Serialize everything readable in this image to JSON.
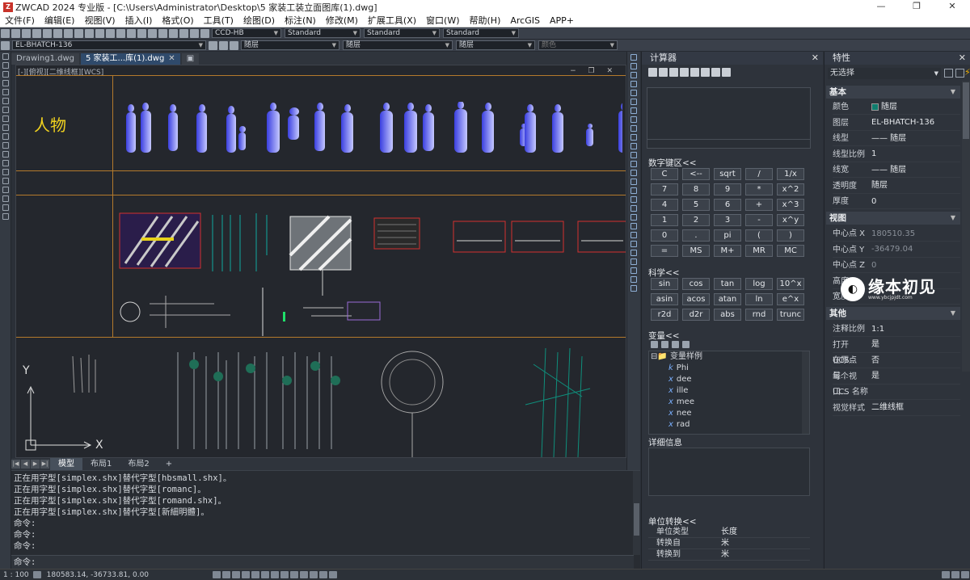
{
  "title_bar": {
    "text": "ZWCAD 2024 专业版 - [C:\\Users\\Administrator\\Desktop\\5 家装工装立面图库(1).dwg]",
    "controls": [
      "—",
      "❐",
      "✕"
    ]
  },
  "menu": [
    "文件(F)",
    "编辑(E)",
    "视图(V)",
    "插入(I)",
    "格式(O)",
    "工具(T)",
    "绘图(D)",
    "标注(N)",
    "修改(M)",
    "扩展工具(X)",
    "窗口(W)",
    "帮助(H)",
    "ArcGIS",
    "APP+"
  ],
  "toolbar": {
    "text_style": "CCD-HB",
    "dim_style": "Standard",
    "table_style": "Standard",
    "multileader_style": "Standard",
    "layer": "EL-BHATCH-136",
    "color": "随层",
    "linetype": "随层",
    "lineweight": "随层",
    "plot_style": "颜色"
  },
  "doc_tabs": [
    {
      "label": "Drawing1.dwg",
      "active": false
    },
    {
      "label": "5 家装工...库(1).dwg",
      "active": true
    }
  ],
  "viewport": {
    "label": "[-][俯视][二维线框][WCS]",
    "controls": "− ❐ ✕",
    "section_title": "人物",
    "ucs_y": "Y",
    "ucs_x": "X"
  },
  "layout_tabs": [
    "模型",
    "布局1",
    "布局2",
    "+"
  ],
  "command": {
    "lines": [
      "正在用字型[simplex.shx]替代字型[hbsmall.shx]。",
      "正在用字型[simplex.shx]替代字型[romanc]。",
      "正在用字型[simplex.shx]替代字型[romand.shx]。",
      "正在用字型[simplex.shx]替代字型[新細明體]。",
      "命令:",
      "命令:",
      "命令:"
    ],
    "prompt": "命令:"
  },
  "status": {
    "scale": "1 : 100",
    "coords": "180583.14, -36733.81, 0.00"
  },
  "calculator": {
    "title": "计算器",
    "numpad_title": "数字键区<<",
    "numpad": [
      [
        "C",
        "<--",
        "sqrt",
        "/",
        "1/x"
      ],
      [
        "7",
        "8",
        "9",
        "*",
        "x^2"
      ],
      [
        "4",
        "5",
        "6",
        "+",
        "x^3"
      ],
      [
        "1",
        "2",
        "3",
        "-",
        "x^y"
      ],
      [
        "0",
        ".",
        "pi",
        "(",
        ")"
      ],
      [
        "=",
        "MS",
        "M+",
        "MR",
        "MC"
      ]
    ],
    "sci_title": "科学<<",
    "sci": [
      [
        "sin",
        "cos",
        "tan",
        "log",
        "10^x"
      ],
      [
        "asin",
        "acos",
        "atan",
        "ln",
        "e^x"
      ],
      [
        "r2d",
        "d2r",
        "abs",
        "rnd",
        "trunc"
      ]
    ],
    "var_title": "变量<<",
    "var_root": "变量样例",
    "vars": [
      {
        "k": "k",
        "name": "Phi"
      },
      {
        "k": "x",
        "name": "dee"
      },
      {
        "k": "x",
        "name": "ille"
      },
      {
        "k": "x",
        "name": "mee"
      },
      {
        "k": "x",
        "name": "nee"
      },
      {
        "k": "x",
        "name": "rad"
      }
    ],
    "details_title": "详细信息",
    "conv_title": "单位转换<<",
    "conv": [
      {
        "k": "单位类型",
        "v": "长度"
      },
      {
        "k": "转换自",
        "v": "米"
      },
      {
        "k": "转换到",
        "v": "米"
      }
    ]
  },
  "properties": {
    "title": "特性",
    "selection": "无选择",
    "cat_basic": "基本",
    "basic": [
      {
        "k": "颜色",
        "v": "随层",
        "swatch": true
      },
      {
        "k": "图层",
        "v": "EL-BHATCH-136"
      },
      {
        "k": "线型",
        "v": "—— 随层"
      },
      {
        "k": "线型比例",
        "v": "1"
      },
      {
        "k": "线宽",
        "v": "—— 随层"
      },
      {
        "k": "透明度",
        "v": "随层"
      },
      {
        "k": "厚度",
        "v": "0"
      }
    ],
    "cat_view": "视图",
    "view": [
      {
        "k": "中心点 X",
        "v": "180510.35"
      },
      {
        "k": "中心点 Y",
        "v": "-36479.04"
      },
      {
        "k": "中心点 Z",
        "v": "0"
      },
      {
        "k": "高度",
        "v": ""
      },
      {
        "k": "宽度",
        "v": ""
      }
    ],
    "cat_other": "其他",
    "other": [
      {
        "k": "注释比例",
        "v": "1:1"
      },
      {
        "k": "打开 UCS...",
        "v": "是"
      },
      {
        "k": "在原点显...",
        "v": "否"
      },
      {
        "k": "每个视口...",
        "v": "是"
      },
      {
        "k": "UCS 名称",
        "v": ""
      },
      {
        "k": "视觉样式",
        "v": "二维线框"
      }
    ]
  },
  "watermark": {
    "text": "缘本初见",
    "sub": "www.ybcjpjdt.com"
  }
}
